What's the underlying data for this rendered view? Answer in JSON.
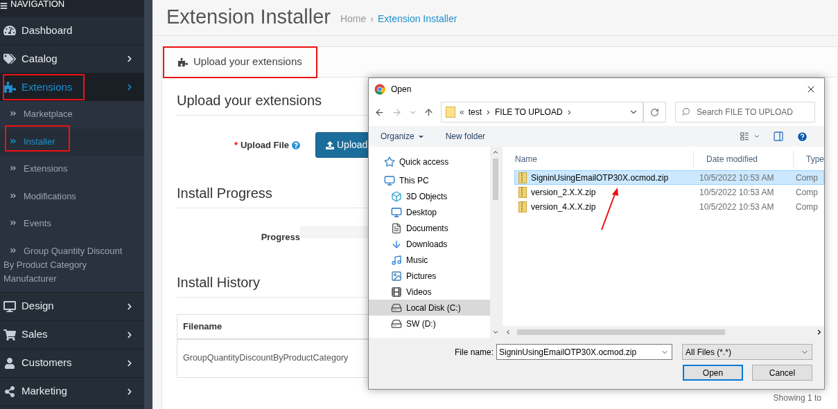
{
  "sidebar": {
    "heading": "NAVIGATION",
    "items": [
      {
        "label": "Dashboard",
        "kind": "dashboard",
        "selected": false,
        "annotated": false,
        "has_submenu": false
      },
      {
        "label": "Catalog",
        "kind": "catalog",
        "selected": false,
        "annotated": false,
        "has_submenu": true
      },
      {
        "label": "Extensions",
        "kind": "extensions",
        "selected": true,
        "annotated": true,
        "has_submenu": true,
        "expanded": true,
        "children": [
          {
            "label": "Marketplace",
            "selected": false,
            "annotated": false
          },
          {
            "label": "Installer",
            "selected": true,
            "annotated": true
          },
          {
            "label": "Extensions",
            "selected": false,
            "annotated": false
          },
          {
            "label": "Modifications",
            "selected": false,
            "annotated": false
          },
          {
            "label": "Events",
            "selected": false,
            "annotated": false
          },
          {
            "label": "Group Quantity Discount By Product Category Manufacturer",
            "selected": false,
            "annotated": false
          }
        ]
      },
      {
        "label": "Design",
        "kind": "design",
        "selected": false,
        "annotated": false,
        "has_submenu": true
      },
      {
        "label": "Sales",
        "kind": "sales",
        "selected": false,
        "annotated": false,
        "has_submenu": true
      },
      {
        "label": "Customers",
        "kind": "customers",
        "selected": false,
        "annotated": false,
        "has_submenu": true
      },
      {
        "label": "Marketing",
        "kind": "marketing",
        "selected": false,
        "annotated": false,
        "has_submenu": true
      }
    ]
  },
  "page": {
    "title": "Extension Installer",
    "breadcrumbs": [
      "Home",
      "Extension Installer"
    ],
    "breadcrumb_separator": "›",
    "panel": {
      "heading": "Upload your extensions",
      "annotated": true,
      "upload_section": {
        "title": "Upload your extensions",
        "field_label": "Upload File",
        "required_mark": "*",
        "button": "Upload"
      },
      "progress_section": {
        "title": "Install Progress",
        "label": "Progress",
        "level": 0
      },
      "history_section": {
        "title": "Install History",
        "columns": [
          "Filename"
        ],
        "rows": [
          [
            "GroupQuantityDiscountByProductCategory"
          ]
        ],
        "footer": "Showing 1 to"
      }
    }
  },
  "dialog": {
    "title": "Open",
    "path_prefix": "«",
    "path": [
      "test",
      "FILE TO UPLOAD"
    ],
    "search": {
      "placeholder": "Search FILE TO UPLOAD"
    },
    "toolbar": {
      "organize": "Organize",
      "new_folder": "New folder"
    },
    "tree": [
      {
        "label": "Quick access",
        "kind": "star",
        "selected": false
      },
      {
        "label": "This PC",
        "kind": "pc",
        "selected": false,
        "children": [
          {
            "label": "3D Objects",
            "kind": "cube",
            "selected": false
          },
          {
            "label": "Desktop",
            "kind": "desktop",
            "selected": false
          },
          {
            "label": "Documents",
            "kind": "documents",
            "selected": false
          },
          {
            "label": "Downloads",
            "kind": "downloads",
            "selected": false
          },
          {
            "label": "Music",
            "kind": "music",
            "selected": false
          },
          {
            "label": "Pictures",
            "kind": "pictures",
            "selected": false
          },
          {
            "label": "Videos",
            "kind": "videos",
            "selected": false
          },
          {
            "label": "Local Disk (C:)",
            "kind": "disk",
            "selected": true
          },
          {
            "label": "SW (D:)",
            "kind": "disk",
            "selected": false
          }
        ]
      }
    ],
    "columns": [
      "Name",
      "Date modified",
      "Type"
    ],
    "files": [
      {
        "name": "SigninUsingEmailOTP30X.ocmod.zip",
        "date": "10/5/2022 10:53 AM",
        "type": "Comp",
        "selected": true
      },
      {
        "name": "version_2.X.X.zip",
        "date": "10/5/2022 10:53 AM",
        "type": "Comp",
        "selected": false
      },
      {
        "name": "version_4.X.X.zip",
        "date": "10/5/2022 10:53 AM",
        "type": "Comp",
        "selected": false
      }
    ],
    "annotation_arrow": true,
    "file_name_label": "File name:",
    "file_name": "SigninUsingEmailOTP30X.ocmod.zip",
    "filter": "All Files (*.*)",
    "buttons": [
      "Open",
      "Cancel"
    ]
  }
}
